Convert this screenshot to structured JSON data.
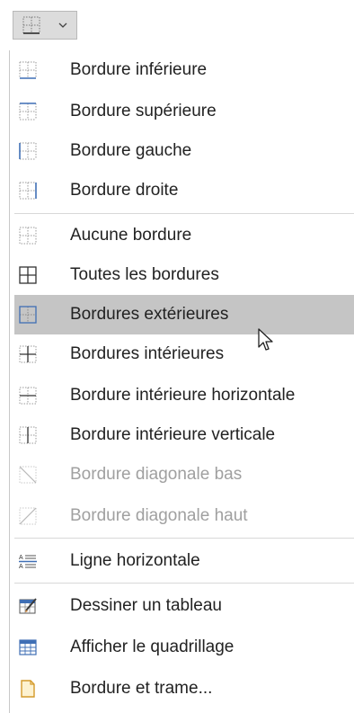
{
  "toolbar": {
    "button_icon": "border-icon",
    "dropdown_icon": "chevron-down-icon"
  },
  "menu": {
    "items": [
      {
        "label": "Bordure inférieure",
        "icon": "bottom-border-icon",
        "disabled": false
      },
      {
        "label": "Bordure supérieure",
        "icon": "top-border-icon",
        "disabled": false
      },
      {
        "label": "Bordure gauche",
        "icon": "left-border-icon",
        "disabled": false
      },
      {
        "label": "Bordure droite",
        "icon": "right-border-icon",
        "disabled": false
      },
      {
        "label": "Aucune bordure",
        "icon": "no-border-icon",
        "disabled": false
      },
      {
        "label": "Toutes les bordures",
        "icon": "all-borders-icon",
        "disabled": false
      },
      {
        "label": "Bordures extérieures",
        "icon": "outside-borders-icon",
        "disabled": false
      },
      {
        "label": "Bordures intérieures",
        "icon": "inside-borders-icon",
        "disabled": false
      },
      {
        "label": "Bordure intérieure horizontale",
        "icon": "inside-horizontal-border-icon",
        "disabled": false
      },
      {
        "label": "Bordure intérieure verticale",
        "icon": "inside-vertical-border-icon",
        "disabled": false
      },
      {
        "label": "Bordure diagonale bas",
        "icon": "diagonal-down-border-icon",
        "disabled": true
      },
      {
        "label": "Bordure diagonale haut",
        "icon": "diagonal-up-border-icon",
        "disabled": true
      },
      {
        "label": "Ligne horizontale",
        "icon": "horizontal-line-icon",
        "disabled": false
      },
      {
        "label": "Dessiner un tableau",
        "icon": "draw-table-icon",
        "disabled": false
      },
      {
        "label": "Afficher le quadrillage",
        "icon": "view-gridlines-icon",
        "disabled": false
      },
      {
        "label": "Bordure et trame...",
        "icon": "borders-shading-icon",
        "disabled": false
      }
    ],
    "highlighted_index": 6
  },
  "colors": {
    "highlight": "#c5c5c5",
    "icon_blue": "#3f6fb5",
    "disabled_text": "#a0a0a0"
  }
}
